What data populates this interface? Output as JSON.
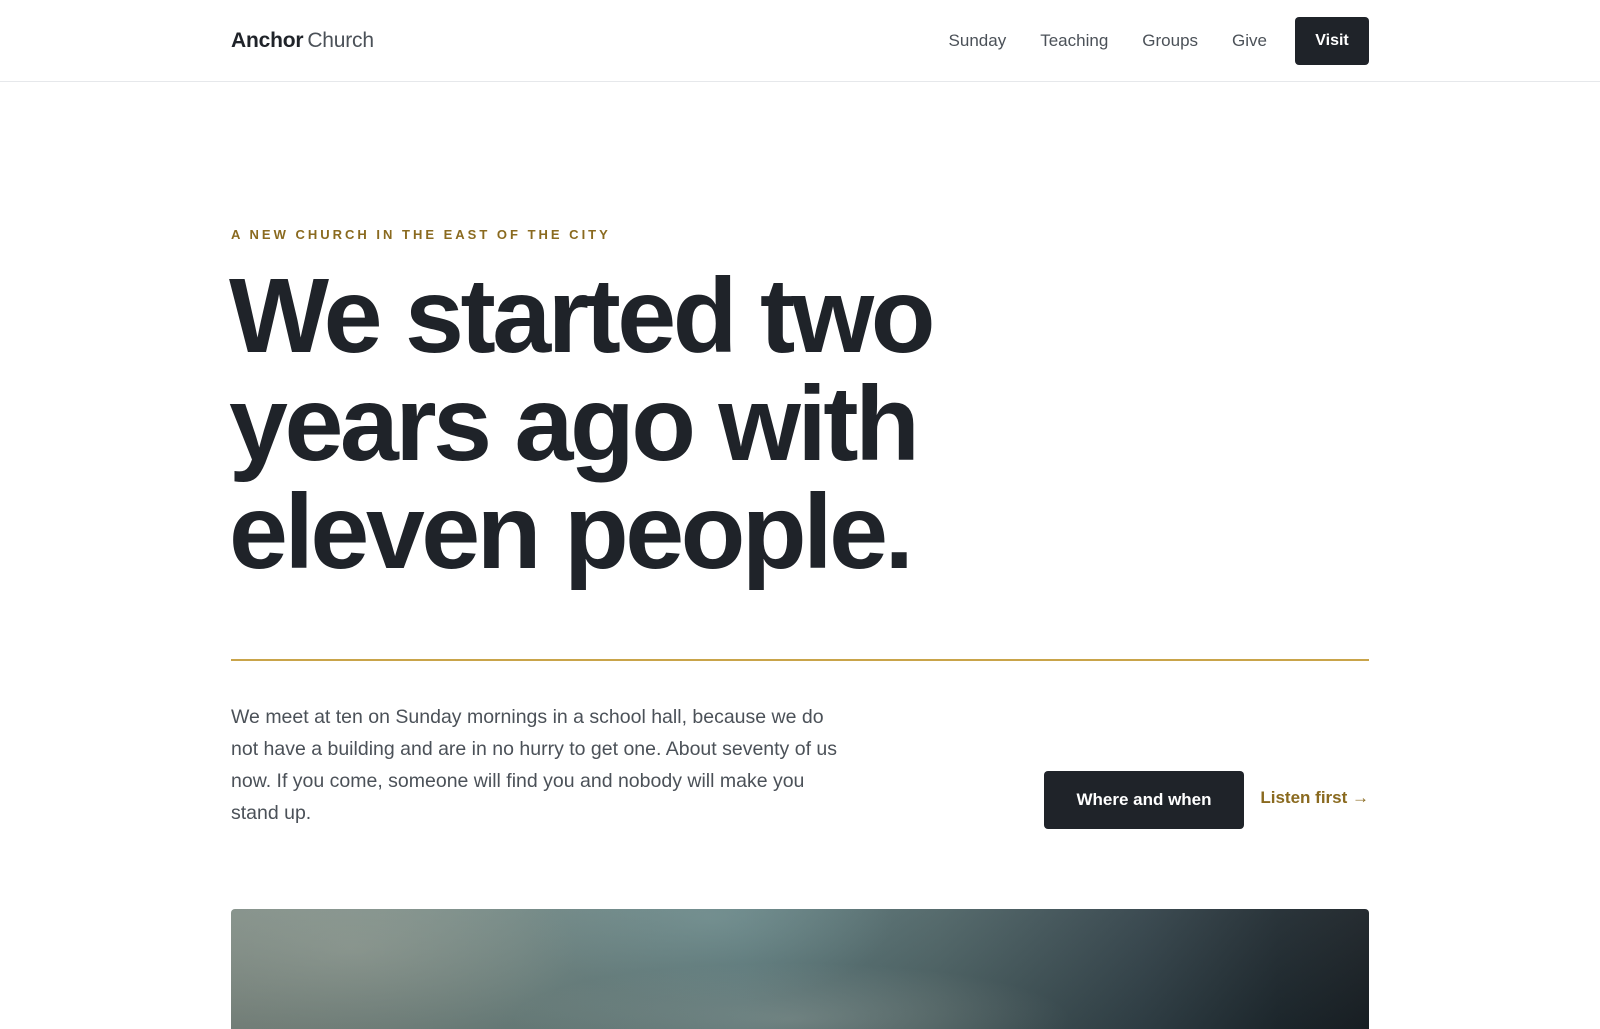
{
  "header": {
    "brand_name": "Anchor",
    "brand_suffix": "Church",
    "nav": [
      {
        "label": "Sunday"
      },
      {
        "label": "Teaching"
      },
      {
        "label": "Groups"
      },
      {
        "label": "Give"
      }
    ],
    "visit_label": "Visit"
  },
  "hero": {
    "eyebrow": "A NEW CHURCH IN THE EAST OF THE CITY",
    "headline": "We started two years ago with eleven people.",
    "intro": "We meet at ten on Sunday mornings in a school hall, because we do not have a building and are in no hurry to get one. About seventy of us now. If you come, someone will find you and nobody will make you stand up.",
    "primary_cta": "Where and when",
    "secondary_cta": "Listen first →"
  },
  "colors": {
    "ink": "#1f2329",
    "muted": "#4b5158",
    "accent_gold": "#8a6a1f",
    "rule_gold": "#c9a44a"
  }
}
